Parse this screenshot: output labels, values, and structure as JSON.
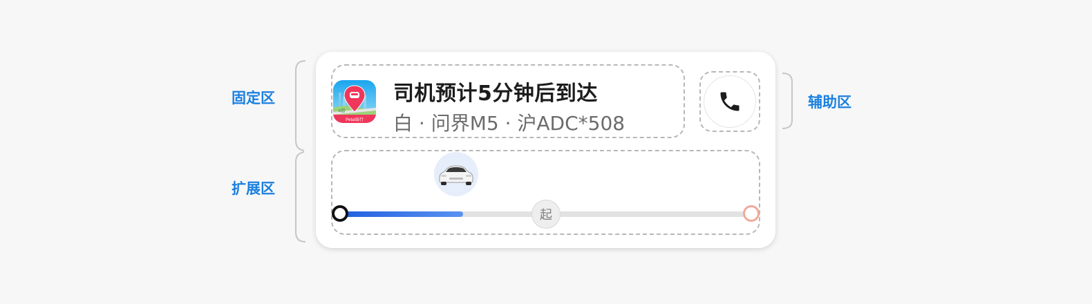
{
  "zones": {
    "fixed_label": "固定区",
    "extended_label": "扩展区",
    "auxiliary_label": "辅助区"
  },
  "card": {
    "app_icon": {
      "name": "petal-travel-app-icon",
      "brand_text": "Petal出行",
      "map_tag": "公园"
    },
    "title": "司机预计5分钟后到达",
    "subtitle": "白 · 问界M5 · 沪ADC*508",
    "call_button_icon": "phone-icon",
    "progress": {
      "fraction": 0.3,
      "pickup_marker_label": "起",
      "pickup_position_fraction": 0.5
    }
  },
  "colors": {
    "label_blue": "#1a7fe0",
    "progress_blue": "#1f5fe0",
    "end_dot": "#f2a89a",
    "brand_red": "#f0365a"
  }
}
